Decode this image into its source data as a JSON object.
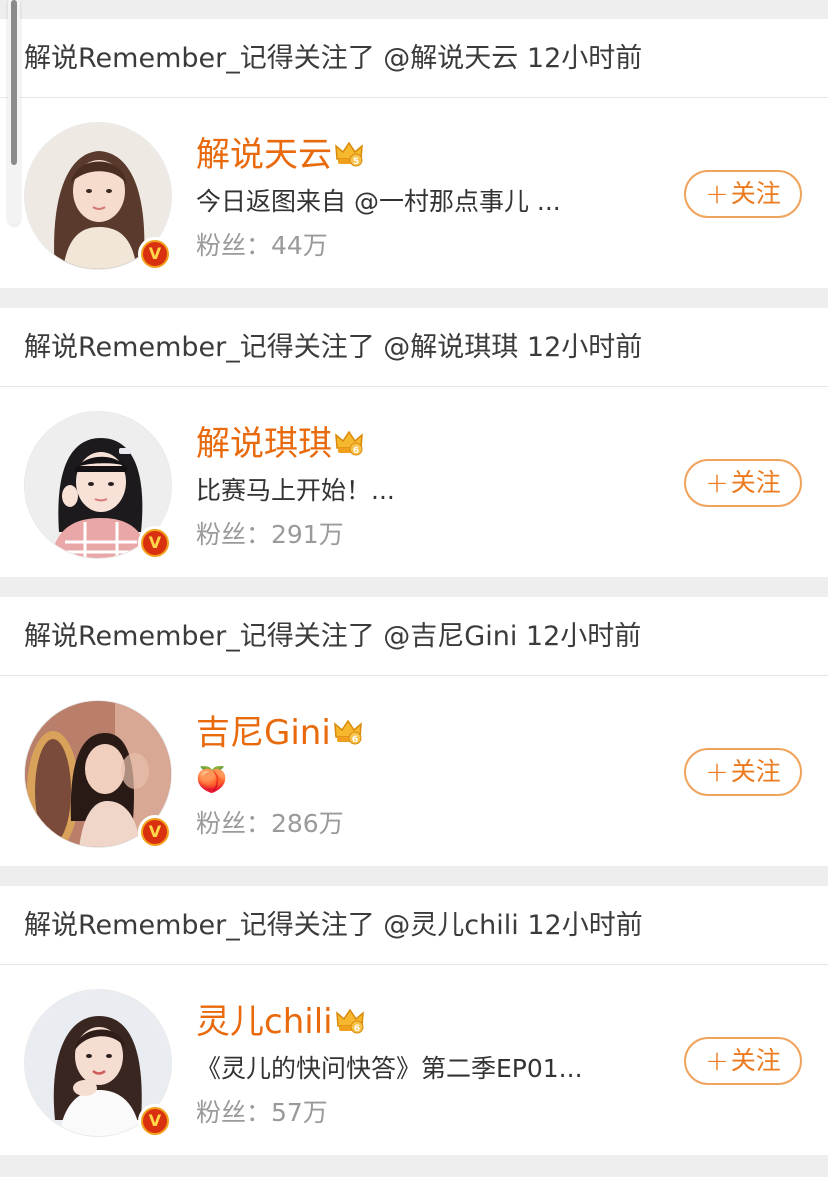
{
  "feed": {
    "items": [
      {
        "action": "解说Remember_记得关注了 @解说天云 12小时前",
        "name": "解说天云",
        "bio": "今日返图来自 @一村那点事儿 ...",
        "fans": "粉丝：44万",
        "follow_label": "关注",
        "level": "5"
      },
      {
        "action": "解说Remember_记得关注了 @解说琪琪 12小时前",
        "name": "解说琪琪",
        "bio": "比赛马上开始！...",
        "fans": "粉丝：291万",
        "follow_label": "关注",
        "level": "6"
      },
      {
        "action": "解说Remember_记得关注了 @吉尼Gini 12小时前",
        "name": "吉尼Gini",
        "bio": "🍑",
        "fans": "粉丝：286万",
        "follow_label": "关注",
        "level": "6"
      },
      {
        "action": "解说Remember_记得关注了 @灵儿chili 12小时前",
        "name": "灵儿chili",
        "bio": "《灵儿的快问快答》第二季EP01...",
        "fans": "粉丝：57万",
        "follow_label": "关注",
        "level": "6"
      }
    ],
    "verified_label": "V",
    "plus_symbol": "+"
  },
  "colors": {
    "name": "#e86a0c",
    "follow_border": "#f0a35c",
    "verified": "#d9300f",
    "background": "#eeeeee"
  }
}
